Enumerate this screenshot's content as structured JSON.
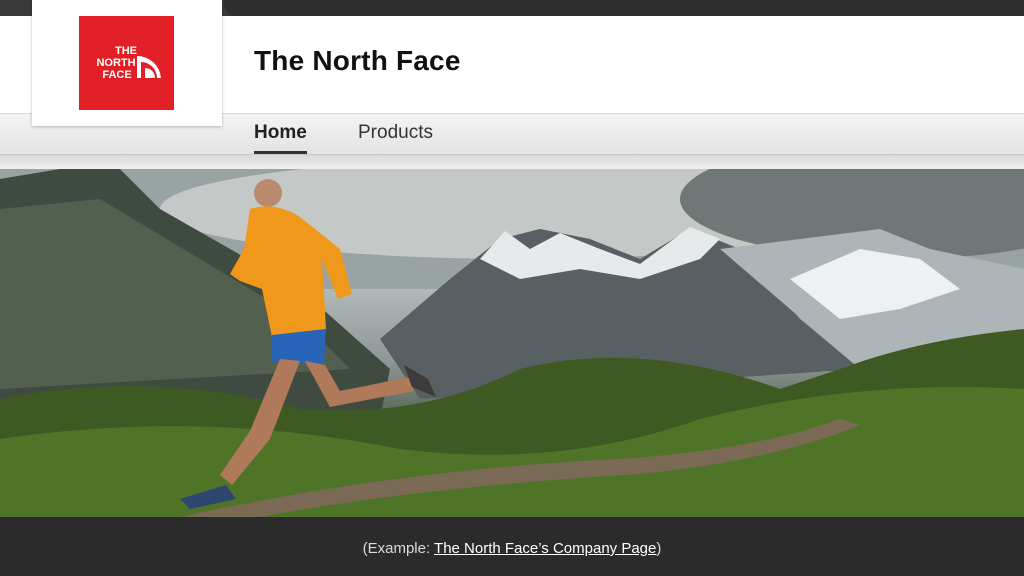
{
  "company": {
    "name": "The North Face",
    "logo_text": [
      "THE",
      "NORTH",
      "FACE"
    ],
    "brand_color": "#e21f26"
  },
  "nav": {
    "tabs": [
      {
        "label": "Home",
        "active": true
      },
      {
        "label": "Products",
        "active": false
      }
    ]
  },
  "hero": {
    "icon": "cover-photo-trail-runner"
  },
  "caption": {
    "prefix": "(Example: ",
    "link_text": "The North Face’s Company Page",
    "suffix": ")"
  }
}
